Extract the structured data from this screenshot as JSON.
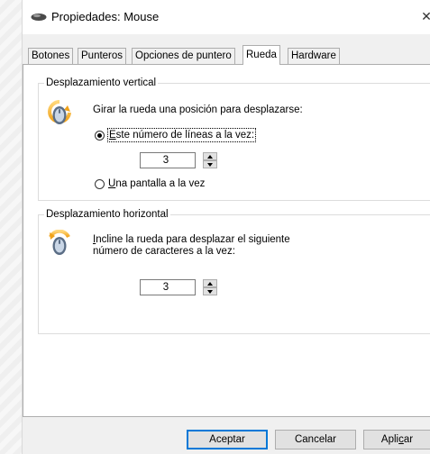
{
  "window": {
    "title": "Propiedades: Mouse",
    "close_glyph": "✕"
  },
  "tabs": [
    {
      "label": "Botones"
    },
    {
      "label": "Punteros"
    },
    {
      "label": "Opciones de puntero"
    },
    {
      "label": "Rueda",
      "active": true
    },
    {
      "label": "Hardware"
    }
  ],
  "vertical": {
    "legend": "Desplazamiento vertical",
    "description": "Girar la rueda una posición para desplazarse:",
    "option_lines": {
      "label_prefix": "E",
      "label_rest": "ste número de líneas a la vez:",
      "selected": true
    },
    "lines_value": "3",
    "option_screen": {
      "label_prefix": "U",
      "label_rest": "na pantalla a la vez",
      "selected": false
    }
  },
  "horizontal": {
    "legend": "Desplazamiento horizontal",
    "description_line1_prefix": "I",
    "description_line1_rest": "ncline la rueda para desplazar el siguiente",
    "description_line2": "número de caracteres a la vez:",
    "chars_value": "3"
  },
  "buttons": {
    "accept": "Aceptar",
    "cancel": "Cancelar",
    "apply_before": "Apli",
    "apply_underlined": "c",
    "apply_after": "ar"
  },
  "icons": {
    "title": "mouse-icon",
    "wheel": "mouse-wheel-icon",
    "spin_up": "arrow-up-icon",
    "spin_down": "arrow-down-icon",
    "close": "close-icon"
  },
  "colors": {
    "default_button_border": "#0078d7",
    "window_bg": "#f0f0f0",
    "panel_bg": "#ffffff"
  }
}
